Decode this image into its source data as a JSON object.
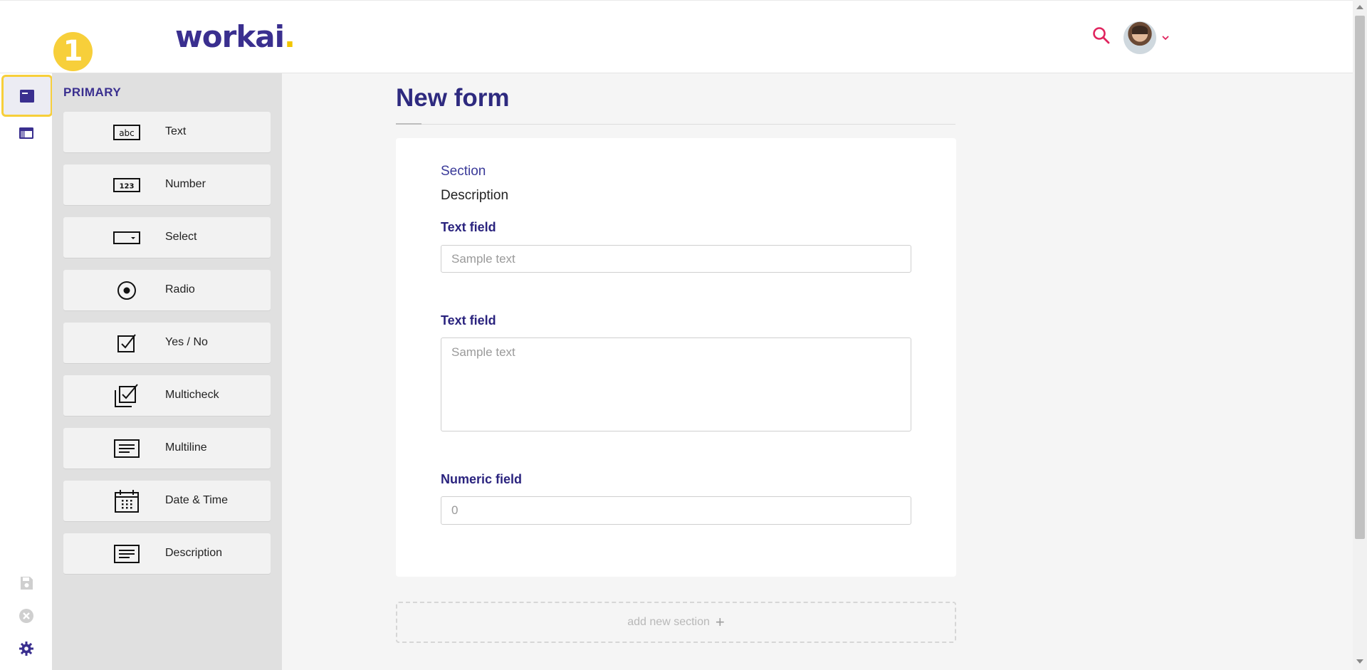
{
  "header": {
    "logo_text": "workai",
    "logo_dot": ".",
    "step_badge": "1"
  },
  "rail": {
    "icons": [
      "form-icon",
      "layout-icon",
      "save-icon",
      "cancel-icon",
      "settings-icon"
    ]
  },
  "palette": {
    "title": "PRIMARY",
    "items": [
      {
        "label": "Text",
        "icon": "text-field-icon"
      },
      {
        "label": "Number",
        "icon": "number-field-icon"
      },
      {
        "label": "Select",
        "icon": "select-field-icon"
      },
      {
        "label": "Radio",
        "icon": "radio-icon"
      },
      {
        "label": "Yes / No",
        "icon": "checkbox-icon"
      },
      {
        "label": "Multicheck",
        "icon": "multicheck-icon"
      },
      {
        "label": "Multiline",
        "icon": "multiline-icon"
      },
      {
        "label": "Date & Time",
        "icon": "calendar-icon"
      },
      {
        "label": "Description",
        "icon": "description-icon"
      }
    ]
  },
  "form": {
    "title": "New form",
    "section": {
      "label": "Section",
      "description": "Description"
    },
    "fields": [
      {
        "label": "Text field",
        "placeholder": "Sample text"
      },
      {
        "label": "Text field",
        "placeholder": "Sample text"
      },
      {
        "label": "Numeric field",
        "placeholder": "0"
      }
    ],
    "add_section_label": "add new section",
    "add_section_plus": "+"
  },
  "colors": {
    "brand": "#3a2f8f",
    "accent": "#f7cf3a",
    "search": "#e0245e"
  }
}
